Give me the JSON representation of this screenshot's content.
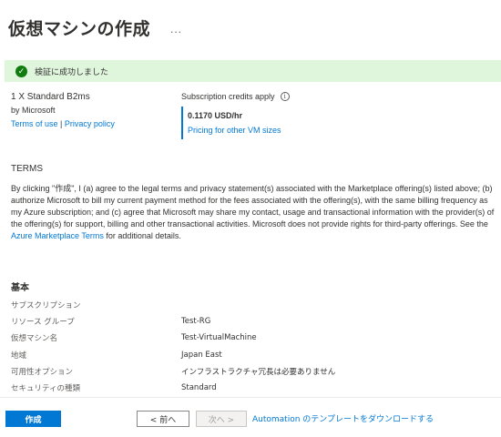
{
  "header": {
    "title": "仮想マシンの作成",
    "more_label": "..."
  },
  "banner": {
    "icon": "check-circle-icon",
    "text": "検証に成功しました",
    "color": "#dff6dd"
  },
  "offer": {
    "title": "1 X Standard B2ms",
    "publisher": "by Microsoft",
    "terms_link": "Terms of use",
    "separator": "|",
    "privacy_link": "Privacy policy",
    "credits_label": "Subscription credits apply",
    "price": "0.1170 USD/hr",
    "pricing_link": "Pricing for other VM sizes"
  },
  "terms": {
    "heading": "TERMS",
    "body_prefix": "By clicking \"作成\", I (a) agree to the legal terms and privacy statement(s) associated with the Marketplace offering(s) listed above; (b) authorize Microsoft to bill my current payment method for the fees associated with the offering(s), with the same billing frequency as my Azure subscription; and (c) agree that Microsoft may share my contact, usage and transactional information with the provider(s) of the offering(s) for support, billing and other transactional activities. Microsoft does not provide rights for third-party offerings. See the ",
    "marketplace_link": "Azure Marketplace Terms",
    "body_suffix": " for additional details."
  },
  "basics": {
    "heading": "基本",
    "rows": [
      {
        "label": "サブスクリプション",
        "value": ""
      },
      {
        "label": "リソース グループ",
        "value": "Test-RG"
      },
      {
        "label": "仮想マシン名",
        "value": "Test-VirtualMachine"
      },
      {
        "label": "地域",
        "value": "Japan East"
      },
      {
        "label": "可用性オプション",
        "value": "インフラストラクチャ冗長は必要ありません"
      },
      {
        "label": "セキュリティの種類",
        "value": "Standard"
      }
    ]
  },
  "footer": {
    "create_label": "作成",
    "prev_label": "< 前へ",
    "next_label": "次へ >",
    "download_label": "Automation のテンプレートをダウンロードする"
  },
  "colors": {
    "accent": "#0078d4",
    "success": "#107c10"
  }
}
